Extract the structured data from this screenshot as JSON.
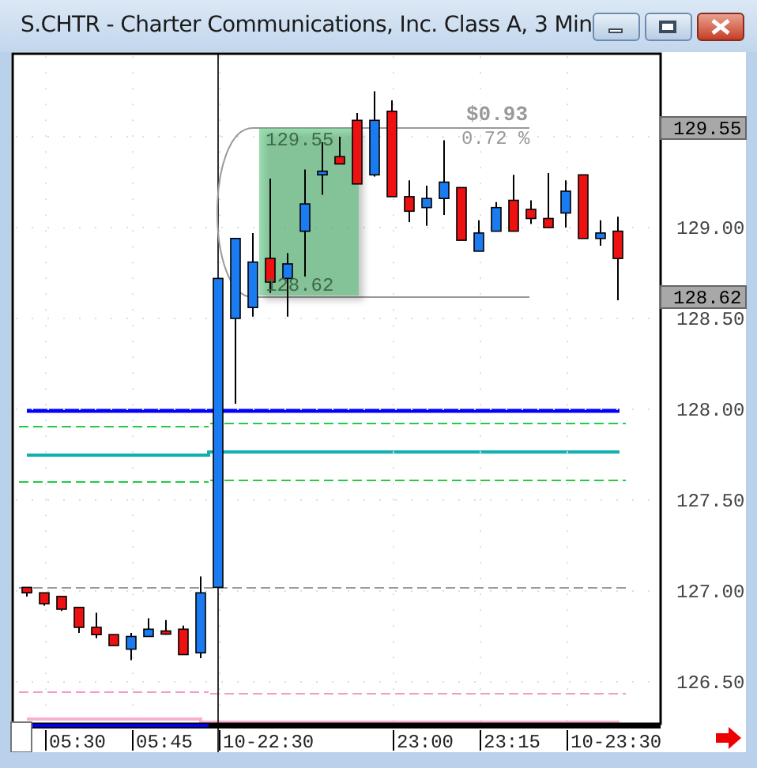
{
  "window": {
    "title": "S.CHTR - Charter Communications, Inc. Class A, 3 Min",
    "controls": [
      {
        "kind": "minimize"
      },
      {
        "kind": "maximize"
      },
      {
        "kind": "close"
      }
    ]
  },
  "chart_data": {
    "type": "candlestick",
    "ohlc": [
      [
        127.02,
        127.02,
        126.97,
        126.99
      ],
      [
        126.99,
        126.99,
        126.92,
        126.93
      ],
      [
        126.97,
        126.97,
        126.89,
        126.9
      ],
      [
        126.91,
        126.91,
        126.77,
        126.8
      ],
      [
        126.8,
        126.88,
        126.74,
        126.76
      ],
      [
        126.76,
        126.76,
        126.7,
        126.7
      ],
      [
        126.68,
        126.77,
        126.62,
        126.75
      ],
      [
        126.75,
        126.85,
        126.75,
        126.79
      ],
      [
        126.78,
        126.84,
        126.76,
        126.77
      ],
      [
        126.79,
        126.81,
        126.65,
        126.65
      ],
      [
        126.66,
        127.08,
        126.63,
        126.99
      ],
      [
        127.02,
        128.72,
        127.02,
        128.72
      ],
      [
        128.5,
        128.94,
        128.03,
        128.94
      ],
      [
        128.56,
        128.97,
        128.51,
        128.81
      ],
      [
        128.83,
        129.27,
        128.64,
        128.7
      ],
      [
        128.72,
        128.86,
        128.51,
        128.8
      ],
      [
        128.98,
        129.32,
        128.73,
        129.13
      ],
      [
        129.29,
        129.47,
        129.18,
        129.31
      ],
      [
        129.39,
        129.5,
        129.35,
        129.35
      ],
      [
        129.59,
        129.63,
        129.24,
        129.24
      ],
      [
        129.29,
        129.75,
        129.28,
        129.59
      ],
      [
        129.64,
        129.7,
        129.17,
        129.17
      ],
      [
        129.17,
        129.26,
        129.03,
        129.09
      ],
      [
        129.11,
        129.23,
        129.01,
        129.16
      ],
      [
        129.16,
        129.48,
        129.07,
        129.25
      ],
      [
        129.22,
        129.22,
        128.93,
        128.93
      ],
      [
        128.87,
        129.04,
        128.87,
        128.97
      ],
      [
        128.98,
        129.14,
        128.98,
        129.11
      ],
      [
        129.15,
        129.29,
        128.98,
        128.98
      ],
      [
        129.1,
        129.15,
        129.02,
        129.05
      ],
      [
        129.05,
        129.3,
        129.0,
        129.0
      ],
      [
        129.08,
        129.26,
        129.0,
        129.2
      ],
      [
        129.29,
        129.29,
        128.94,
        128.94
      ],
      [
        128.94,
        129.04,
        128.9,
        128.97
      ],
      [
        128.98,
        129.06,
        128.6,
        128.83
      ]
    ],
    "yticks": [
      {
        "value": 129.0,
        "label": "129.00"
      },
      {
        "value": 128.5,
        "label": "128.50"
      },
      {
        "value": 128.0,
        "label": "128.00"
      },
      {
        "value": 127.5,
        "label": "127.50"
      },
      {
        "value": 127.0,
        "label": "127.00"
      },
      {
        "value": 126.5,
        "label": "126.50"
      }
    ],
    "ylim": [
      126.27,
      129.96
    ],
    "grid": true
  },
  "time_axis": {
    "labels": [
      "05:30",
      "05:45",
      "10-22:30",
      "23:00",
      "23:15",
      "10-23:30"
    ]
  },
  "price_tags": [
    "129.55",
    "128.62"
  ],
  "measurement": {
    "high": "129.55",
    "low": "128.62",
    "change": "$0.93",
    "percent": "0.72 %"
  }
}
